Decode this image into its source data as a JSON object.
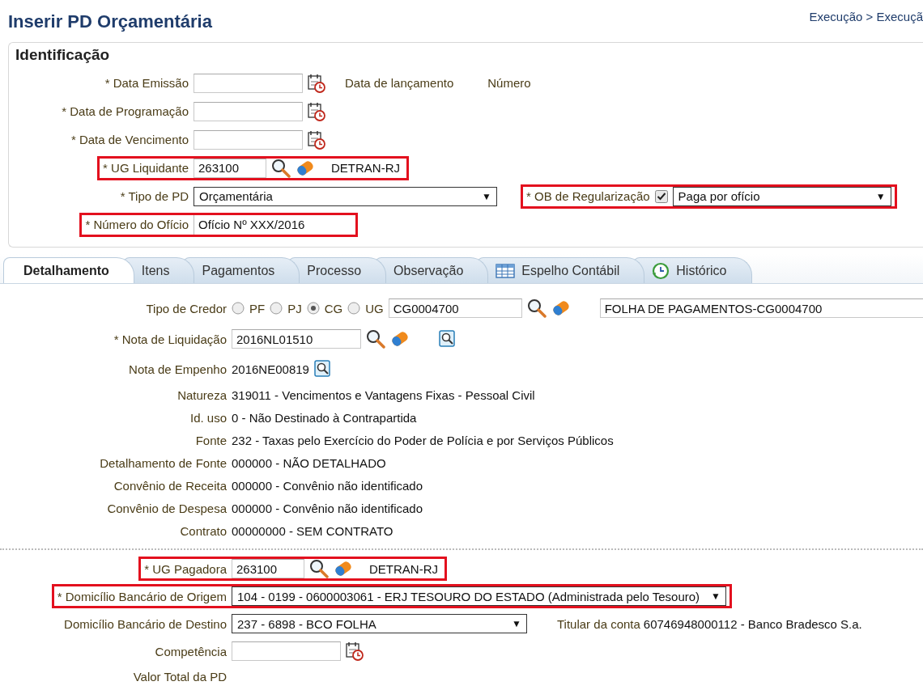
{
  "title": "Inserir PD Orçamentária",
  "breadcrumb": "Execução > Execuçã",
  "identification": {
    "heading": "Identificação",
    "rows": [
      {
        "kind": "date",
        "label": "* Data Emissão",
        "highlighted": false,
        "extras": [
          "Data de lançamento",
          "Número"
        ]
      },
      {
        "kind": "date",
        "label": "* Data de Programação",
        "highlighted": false
      },
      {
        "kind": "date",
        "label": "* Data de Vencimento",
        "highlighted": false
      },
      {
        "kind": "lookup",
        "label": "* UG Liquidante",
        "value": "263100",
        "description": "DETRAN-RJ",
        "highlighted": true
      },
      {
        "kind": "select",
        "label": "* Tipo de PD",
        "value": "Orçamentária",
        "arrow": "▼",
        "highlighted": false,
        "side": {
          "label": "* OB de Regularização",
          "checked": true,
          "value": "Paga por ofício",
          "arrow": "▼",
          "highlighted": true
        }
      },
      {
        "kind": "text",
        "label": "* Número do Ofício",
        "value": "Ofício Nº XXX/2016",
        "highlighted": true
      }
    ]
  },
  "tabs": [
    {
      "label": "Detalhamento",
      "selected": true
    },
    {
      "label": "Itens",
      "selected": false
    },
    {
      "label": "Pagamentos",
      "selected": false
    },
    {
      "label": "Processo",
      "selected": false
    },
    {
      "label": "Observação",
      "selected": false
    },
    {
      "label": "Espelho Contábil",
      "selected": false
    },
    {
      "label": "Histórico",
      "selected": false
    }
  ],
  "detail": {
    "rows": [
      {
        "kind": "credor",
        "label": "Tipo de Credor",
        "options": [
          {
            "label": "PF",
            "selected": false
          },
          {
            "label": "PJ",
            "selected": false
          },
          {
            "label": "CG",
            "selected": true
          },
          {
            "label": "UG",
            "selected": false
          }
        ],
        "value": "CG0004700",
        "description": "FOLHA DE PAGAMENTOS-CG0004700",
        "highlighted": false
      },
      {
        "kind": "lookup_detail",
        "label": "* Nota de Liquidação",
        "value": "2016NL01510",
        "highlighted": false
      },
      {
        "kind": "reference",
        "label": "Nota de Empenho",
        "value": "2016NE00819",
        "highlighted": false
      },
      {
        "kind": "info",
        "label": "Natureza",
        "value": "319011 - Vencimentos e Vantagens Fixas - Pessoal Civil",
        "highlighted": false
      },
      {
        "kind": "info",
        "label": "Id. uso",
        "value": "0 - Não Destinado à Contrapartida",
        "highlighted": false
      },
      {
        "kind": "info",
        "label": "Fonte",
        "value": "232 - Taxas pelo Exercício do Poder de Polícia e por Serviços Públicos",
        "highlighted": false
      },
      {
        "kind": "info",
        "label": "Detalhamento de Fonte",
        "value": "000000 - NÃO DETALHADO",
        "highlighted": false
      },
      {
        "kind": "info",
        "label": "Convênio de Receita",
        "value": "000000 - Convênio não identificado",
        "highlighted": false
      },
      {
        "kind": "info",
        "label": "Convênio de Despesa",
        "value": "000000 - Convênio não identificado",
        "highlighted": false
      },
      {
        "kind": "info",
        "label": "Contrato",
        "value": "00000000 - SEM CONTRATO",
        "highlighted": false
      },
      {
        "kind": "divider"
      },
      {
        "kind": "lookup",
        "label": "* UG Pagadora",
        "value": "263100",
        "description": "DETRAN-RJ",
        "highlighted": true
      },
      {
        "kind": "select",
        "label": "* Domicílio Bancário de Origem",
        "value": "104 - 0199 - 0600003061 - ERJ TESOURO DO ESTADO (Administrada pelo Tesouro)",
        "arrow": "▼",
        "highlighted": true
      },
      {
        "kind": "select",
        "label": "Domicílio Bancário de Destino",
        "value": "237 - 6898 - BCO FOLHA",
        "arrow": "▼",
        "highlighted": false,
        "aside": {
          "label": "Titular da conta",
          "value": "60746948000112 - Banco Bradesco S.a."
        }
      },
      {
        "kind": "date",
        "label": "Competência",
        "highlighted": false
      },
      {
        "kind": "label_only",
        "label": "Valor Total da PD",
        "highlighted": false
      }
    ]
  }
}
